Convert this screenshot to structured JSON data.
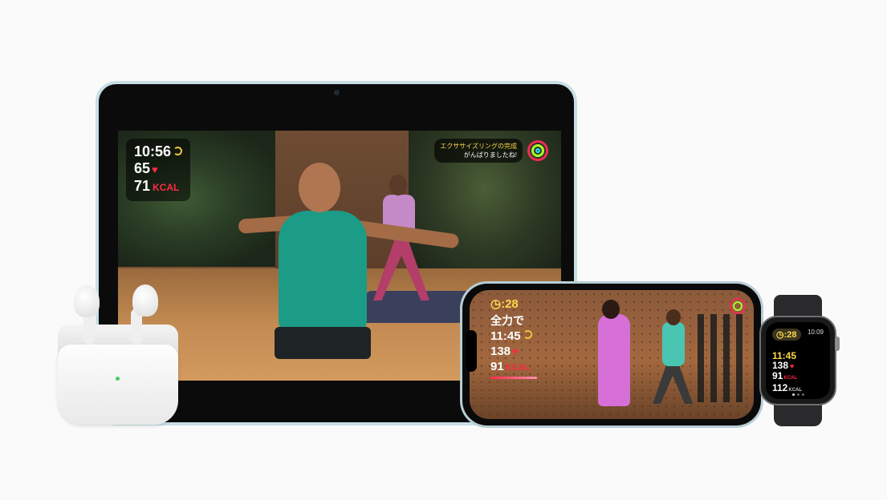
{
  "ipad": {
    "time": "10:56",
    "heart_rate": "65",
    "calories": "71",
    "calories_unit": "KCAL",
    "ring_message_line1": "エクササイズリングの完成",
    "ring_message_line2": "がんばりましたね!"
  },
  "iphone": {
    "timer": ":28",
    "intensity": "全力で",
    "time": "11:45",
    "heart_rate": "138",
    "calories": "91",
    "calories_unit": "KCAL"
  },
  "watch": {
    "timer": ":28",
    "clock": "10:09",
    "time": "11:45",
    "heart_rate": "138",
    "active_calories": "91",
    "active_calories_unit": "KCAL",
    "total_calories": "112",
    "total_calories_unit": "KCAL"
  },
  "colors": {
    "accent_yellow": "#ffd84a",
    "accent_red": "#ff2b47",
    "ring_green": "#a7ff2b",
    "ring_blue": "#2ce4f4"
  },
  "icons": [
    "heart-icon",
    "activity-rings-icon",
    "timer-icon"
  ]
}
